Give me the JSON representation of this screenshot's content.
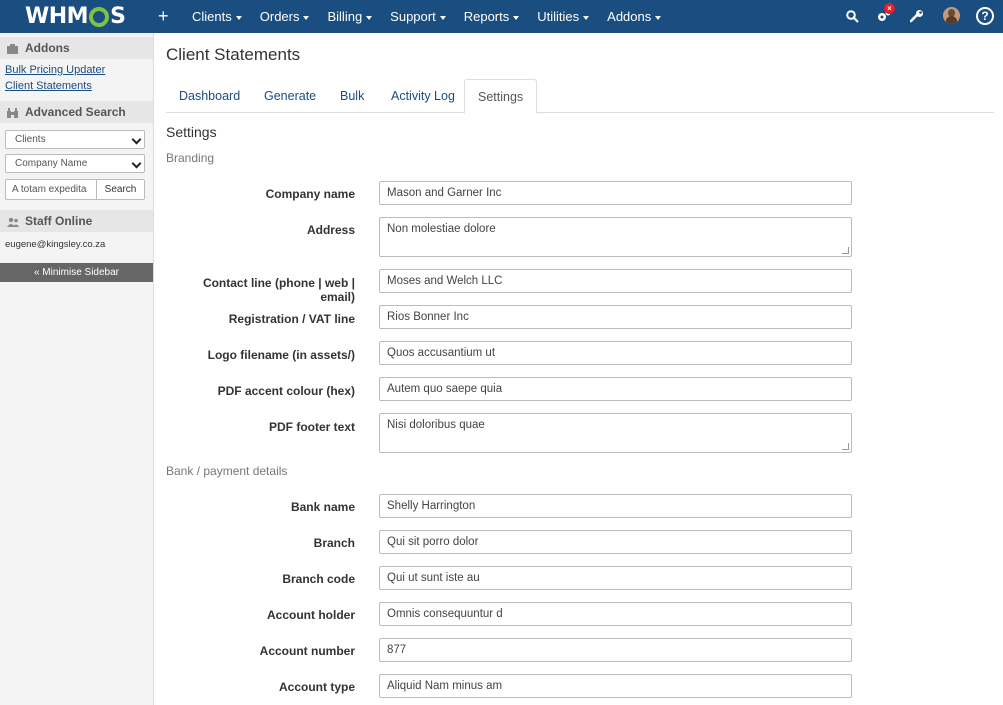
{
  "topnav": {
    "logo": {
      "text_left": "WHM",
      "text_right": "S"
    },
    "menu": [
      {
        "label": "Clients"
      },
      {
        "label": "Orders"
      },
      {
        "label": "Billing"
      },
      {
        "label": "Support"
      },
      {
        "label": "Reports"
      },
      {
        "label": "Utilities"
      },
      {
        "label": "Addons"
      }
    ],
    "badge": "×",
    "help": "?"
  },
  "sidebar": {
    "addons_title": "Addons",
    "addon_links": [
      "Bulk Pricing Updater",
      "Client Statements"
    ],
    "advanced_search_title": "Advanced Search",
    "search_type": "Clients",
    "search_field": "Company Name",
    "search_value": "A totam expedita",
    "search_button": "Search",
    "staff_online_title": "Staff Online",
    "staff_email": "eugene@kingsley.co.za",
    "minimise": "« Minimise Sidebar"
  },
  "main": {
    "title": "Client Statements",
    "tabs": [
      {
        "label": "Dashboard"
      },
      {
        "label": "Generate"
      },
      {
        "label": "Bulk"
      },
      {
        "label": "Activity Log"
      },
      {
        "label": "Settings",
        "active": true
      }
    ],
    "section_title": "Settings",
    "branding_title": "Branding",
    "bank_title": "Bank / payment details",
    "fields": {
      "company_name": {
        "label": "Company name",
        "value": "Mason and Garner Inc"
      },
      "address": {
        "label": "Address",
        "value": "Non molestiae dolore"
      },
      "contact_line": {
        "label": "Contact line (phone | web | email)",
        "value": "Moses and Welch LLC"
      },
      "registration": {
        "label": "Registration / VAT line",
        "value": "Rios Bonner Inc"
      },
      "logo_filename": {
        "label": "Logo filename (in assets/)",
        "value": "Quos accusantium ut"
      },
      "pdf_accent": {
        "label": "PDF accent colour (hex)",
        "value": "Autem quo saepe quia"
      },
      "pdf_footer": {
        "label": "PDF footer text",
        "value": "Nisi doloribus quae"
      },
      "bank_name": {
        "label": "Bank name",
        "value": "Shelly Harrington"
      },
      "branch": {
        "label": "Branch",
        "value": "Qui sit porro dolor"
      },
      "branch_code": {
        "label": "Branch code",
        "value": "Qui ut sunt iste au"
      },
      "account_holder": {
        "label": "Account holder",
        "value": "Omnis consequuntur d"
      },
      "account_number": {
        "label": "Account number",
        "value": "877"
      },
      "account_type": {
        "label": "Account type",
        "value": "Aliquid Nam minus am"
      }
    }
  },
  "colors": {
    "nav_bg": "#1a4d80",
    "link": "#1a4d80",
    "logo_gear": "#7ec242",
    "badge": "#d9232d"
  }
}
